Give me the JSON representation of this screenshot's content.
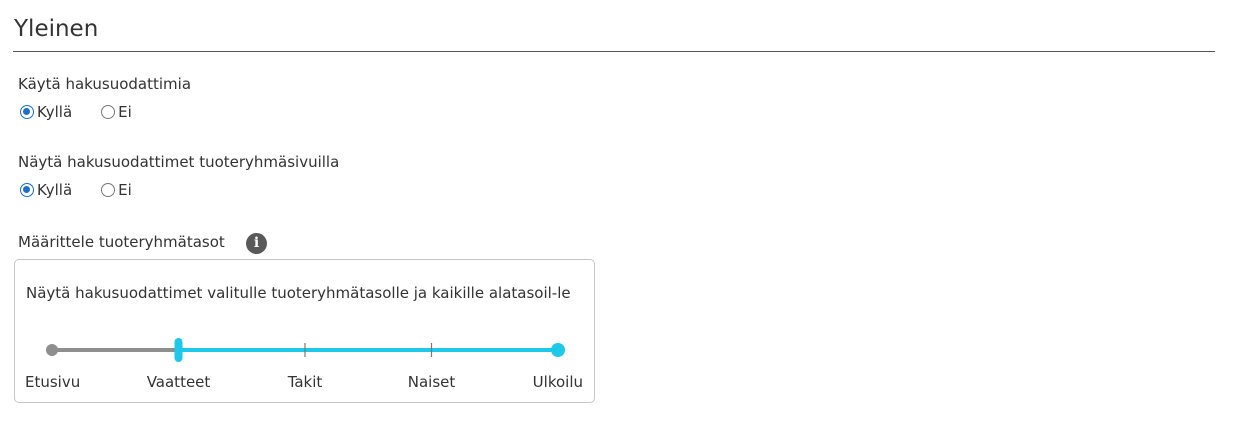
{
  "section": {
    "title": "Yleinen"
  },
  "use_filters": {
    "label": "Käytä hakusuodattimia",
    "options": [
      {
        "label": "Kyllä",
        "checked": true
      },
      {
        "label": "Ei",
        "checked": false
      }
    ]
  },
  "show_on_group_pages": {
    "label": "Näytä hakusuodattimet tuoteryhmäsivuilla",
    "options": [
      {
        "label": "Kyllä",
        "checked": true
      },
      {
        "label": "Ei",
        "checked": false
      }
    ]
  },
  "group_levels": {
    "label": "Määrittele tuoteryhmätasot",
    "info_icon": "info-icon",
    "description": "Näytä hakusuodattimet valitulle tuoteryhmätasolle ja kaikille alatasoil-le",
    "slider": {
      "levels": [
        "Etusivu",
        "Vaatteet",
        "Takit",
        "Naiset",
        "Ulkoilu"
      ],
      "selected_from_index": 1,
      "selected_to_index": 4,
      "active_color": "#1ec8e8",
      "inactive_color": "#8e8e8e"
    }
  },
  "colors": {
    "radio_accent": "#1f6fc9",
    "info_icon_bg": "#595959"
  }
}
